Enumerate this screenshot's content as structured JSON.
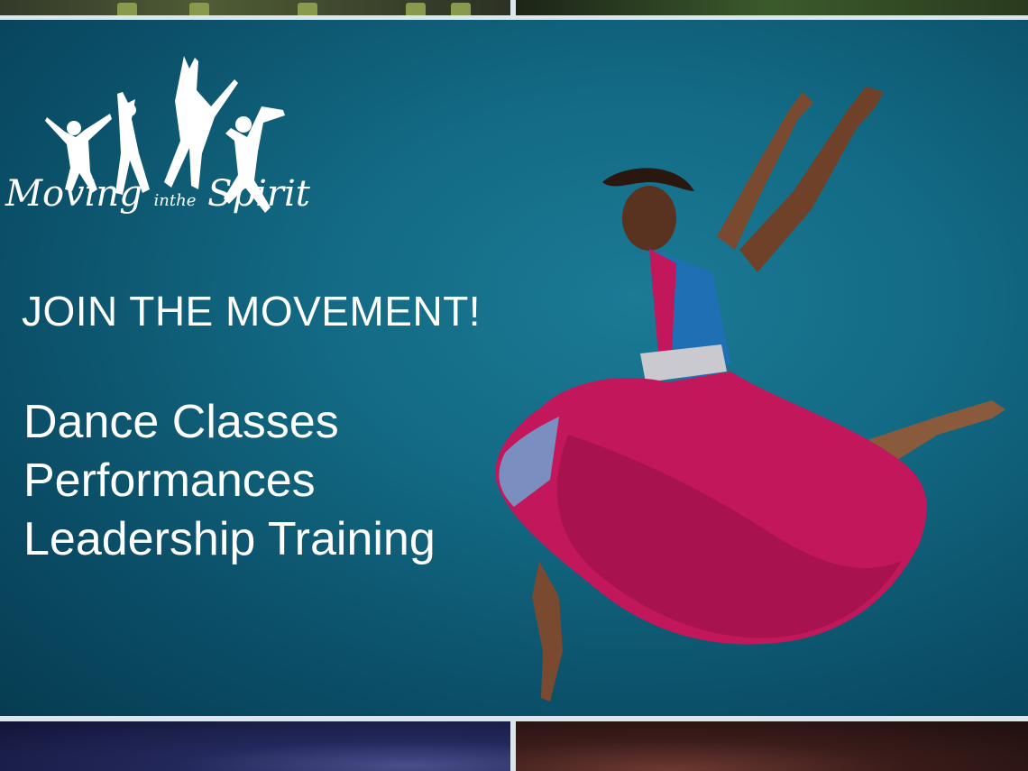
{
  "logo": {
    "text_moving": "Moving",
    "text_in": "in",
    "text_the": "the",
    "text_spirit": "Spirit"
  },
  "headline": "JOIN THE MOVEMENT!",
  "services": [
    "Dance Classes",
    "Performances",
    "Leadership Training"
  ],
  "colors": {
    "background": "#0f5f7a",
    "text": "#ffffff",
    "dress": "#c2185b",
    "top": "#1e6fb4"
  },
  "icons": [
    "jumping-dancers-logo",
    "dancer-photo"
  ]
}
